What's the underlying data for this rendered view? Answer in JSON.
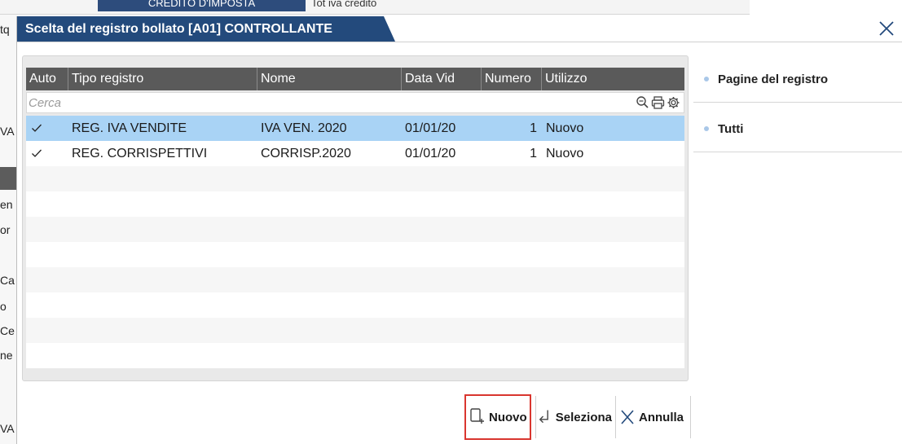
{
  "background": {
    "tab1": "CREDITO D'IMPOSTA",
    "tab2": "Tot iva credito",
    "left_fragments": [
      "tq",
      "VA",
      "en",
      "or",
      "Ca",
      "o",
      "Ce",
      "ne",
      "VA"
    ]
  },
  "dialog": {
    "title": "Scelta del registro bollato [A01] CONTROLLANTE",
    "close_icon": "close-icon"
  },
  "grid": {
    "columns": [
      "Auto",
      "Tipo registro",
      "Nome",
      "Data Vid",
      "Numero",
      "Utilizzo"
    ],
    "search_placeholder": "Cerca",
    "rows": [
      {
        "auto": true,
        "tipo_registro": "REG. IVA VENDITE",
        "nome": "IVA VEN. 2020",
        "data_vid": "01/01/20",
        "numero": "1",
        "utilizzo": "Nuovo"
      },
      {
        "auto": true,
        "tipo_registro": "REG. CORRISPETTIVI",
        "nome": "CORRISP.2020",
        "data_vid": "01/01/20",
        "numero": "1",
        "utilizzo": "Nuovo"
      }
    ],
    "selected_row": 0
  },
  "side": {
    "items": [
      {
        "label": "Pagine del registro"
      },
      {
        "label": "Tutti"
      }
    ]
  },
  "buttons": {
    "nuovo": "Nuovo",
    "seleziona": "Seleziona",
    "annulla": "Annulla"
  },
  "colors": {
    "title_bg": "#234a7c",
    "header_bg": "#5a5a5a",
    "selected_row": "#a9d3f5",
    "highlight_border": "#d9362f"
  }
}
